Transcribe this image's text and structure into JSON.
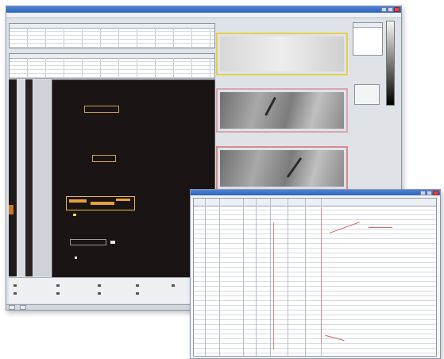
{
  "main_window": {
    "title": "",
    "menu": [
      "",
      "",
      "",
      "",
      "",
      ""
    ]
  },
  "panels": {
    "top_table_label": "",
    "second_table_label": "",
    "thumb1_caption": "",
    "thumb2_caption": "",
    "thumb3_caption": ""
  },
  "colors": {
    "titlebar": "#2f62b8",
    "viewer_bg": "#1a1414",
    "defect": "#e7a13a",
    "thumb1_border": "#e3d24a",
    "thumb2_border": "#d9a5ae",
    "thumb3_border": "#d88a8a"
  },
  "statusbar": {
    "start_label": "",
    "task_label": ""
  },
  "icons": [
    "minimize-icon",
    "maximize-icon",
    "close-icon",
    "grey-scale-bar"
  ],
  "overlay_window": {
    "title": ""
  }
}
